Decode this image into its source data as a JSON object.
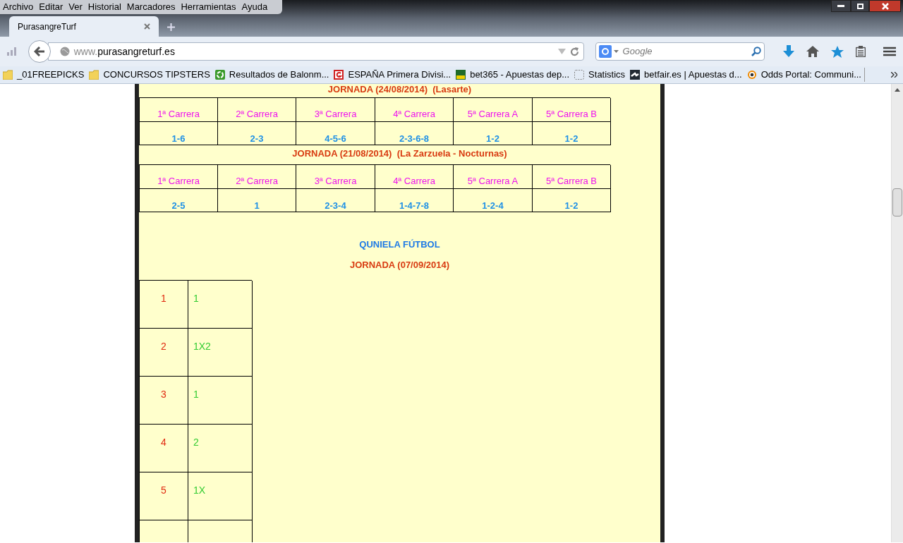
{
  "browser": {
    "menu": [
      "Archivo",
      "Editar",
      "Ver",
      "Historial",
      "Marcadores",
      "Herramientas",
      "Ayuda"
    ],
    "tabs": [
      {
        "title": "PurasangreTurf",
        "selected": true
      }
    ],
    "address": {
      "prefix": "www.",
      "domain": "purasangreturf.es"
    },
    "search": {
      "placeholder": "Google"
    },
    "bookmarks": [
      {
        "label": "_01FREEPICKS",
        "kind": "folder"
      },
      {
        "label": "CONCURSOS TIPSTERS",
        "kind": "folder"
      },
      {
        "label": "Resultados de Balonm...",
        "kind": "refresh"
      },
      {
        "label": "ESPAÑA Primera Divisi...",
        "kind": "red"
      },
      {
        "label": "bet365 - Apuestas dep...",
        "kind": "green"
      },
      {
        "label": "Statistics",
        "kind": "blank"
      },
      {
        "label": "betfair.es | Apuestas d...",
        "kind": "dark"
      },
      {
        "label": "Odds Portal: Communi...",
        "kind": "target"
      }
    ]
  },
  "page": {
    "sections": [
      {
        "title": "JORNADA (24/08/2014)  (Lasarte)",
        "races": [
          {
            "label": "1ª Carrera",
            "result": "1-6"
          },
          {
            "label": "2ª Carrera",
            "result": "2-3"
          },
          {
            "label": "3ª Carrera",
            "result": "4-5-6"
          },
          {
            "label": "4ª Carrera",
            "result": "2-3-6-8"
          },
          {
            "label": "5ª Carrera A",
            "result": "1-2"
          },
          {
            "label": "5ª Carrera B",
            "result": "1-2"
          }
        ]
      },
      {
        "title": "JORNADA (21/08/2014)  (La Zarzuela - Nocturnas)",
        "races": [
          {
            "label": "1ª Carrera",
            "result": "2-5"
          },
          {
            "label": "2ª Carrera",
            "result": "1"
          },
          {
            "label": "3ª Carrera",
            "result": "2-3-4"
          },
          {
            "label": "4ª Carrera",
            "result": "1-4-7-8"
          },
          {
            "label": "5ª Carrera A",
            "result": "1-2-4"
          },
          {
            "label": "5ª Carrera B",
            "result": "1-2"
          }
        ]
      }
    ],
    "quiniela": {
      "title": "QUNIELA FÚTBOL",
      "jornada": "JORNADA (07/09/2014)",
      "rows": [
        {
          "number": "1",
          "pick": "1"
        },
        {
          "number": "2",
          "pick": "1X2"
        },
        {
          "number": "3",
          "pick": "1"
        },
        {
          "number": "4",
          "pick": "2"
        },
        {
          "number": "5",
          "pick": "1X"
        }
      ]
    }
  }
}
